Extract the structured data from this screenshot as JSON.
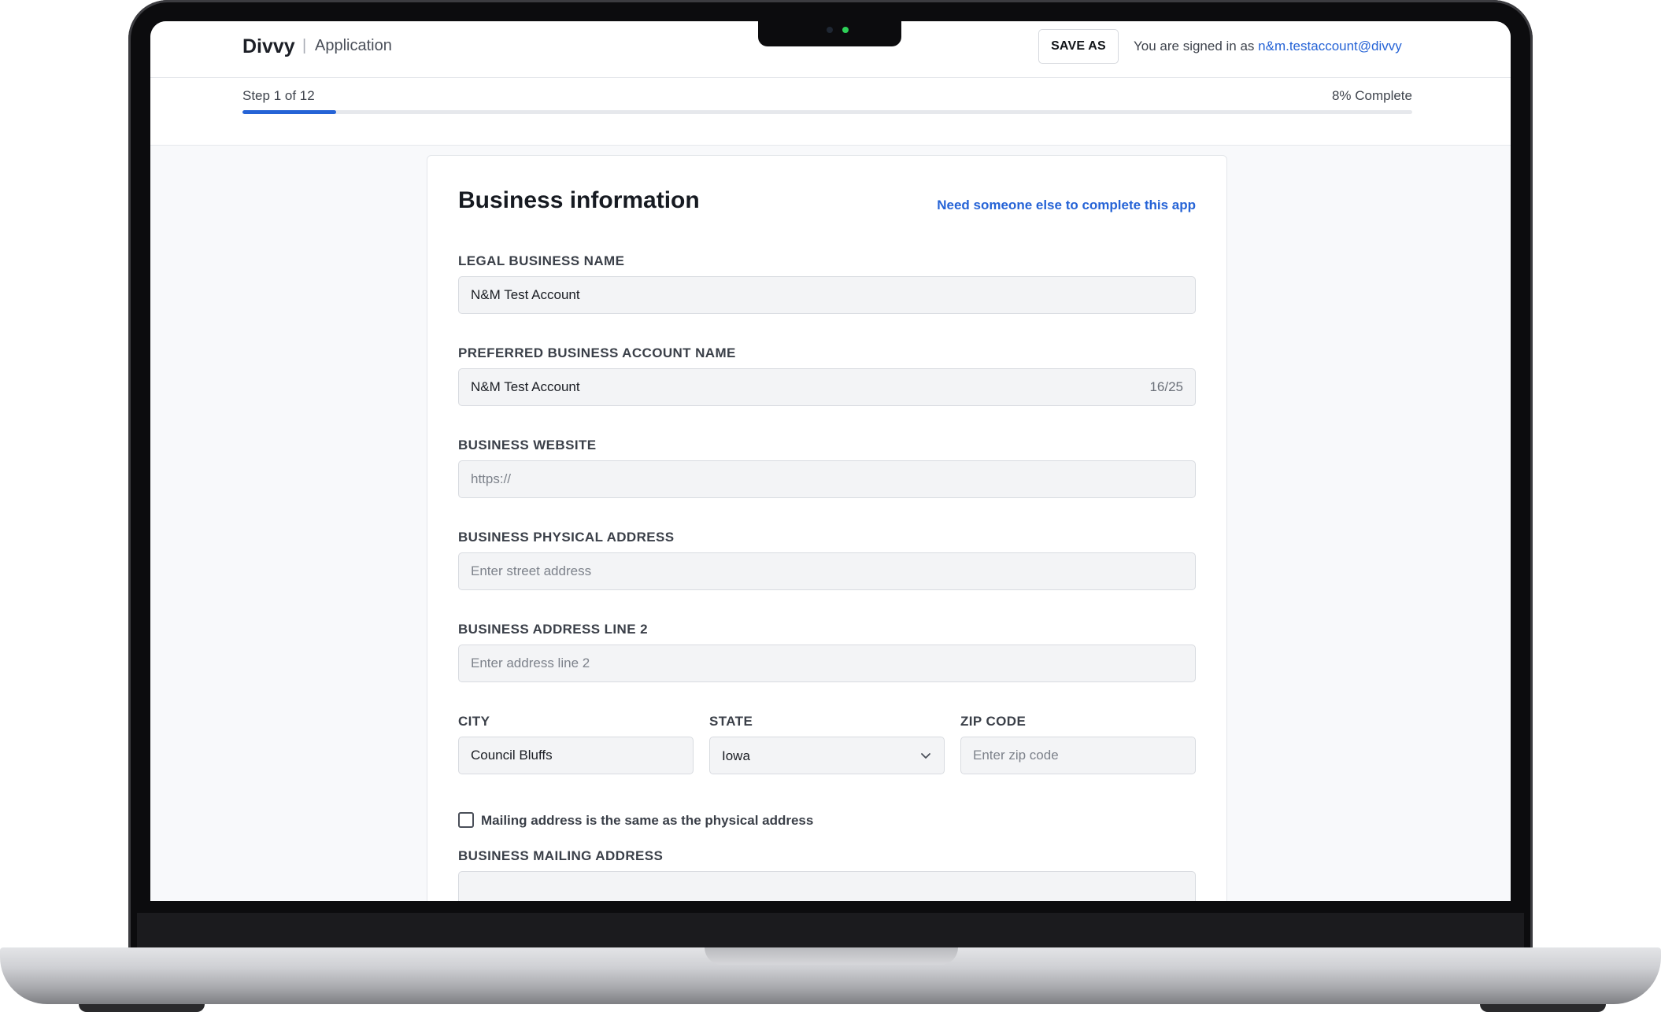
{
  "header": {
    "brand": "Divvy",
    "separator": "|",
    "app_section": "Application",
    "save_as_label": "SAVE AS",
    "signed_in_prefix": "You are signed in as ",
    "user_email": "n&m.testaccount@divvy"
  },
  "progress": {
    "step_text": "Step 1 of 12",
    "complete_text": "8% Complete",
    "percent": 8
  },
  "form": {
    "title": "Business information",
    "help_link": "Need someone else to complete this app",
    "legal_name": {
      "label": "LEGAL BUSINESS NAME",
      "value": "N&M Test Account"
    },
    "account_name": {
      "label": "PREFERRED BUSINESS ACCOUNT NAME",
      "value": "N&M Test Account",
      "char_count": "16/25"
    },
    "website": {
      "label": "BUSINESS WEBSITE",
      "placeholder": "https://"
    },
    "physical_address": {
      "label": "BUSINESS PHYSICAL ADDRESS",
      "placeholder": "Enter street address"
    },
    "address_line2": {
      "label": "BUSINESS ADDRESS LINE 2",
      "placeholder": "Enter address line 2"
    },
    "city": {
      "label": "CITY",
      "value": "Council Bluffs"
    },
    "state": {
      "label": "STATE",
      "value": "Iowa"
    },
    "zip": {
      "label": "ZIP CODE",
      "placeholder": "Enter zip code"
    },
    "mailing_same": {
      "label": "Mailing address is the same as the physical address",
      "checked": false
    },
    "mailing_address": {
      "label": "BUSINESS MAILING ADDRESS"
    }
  },
  "colors": {
    "accent": "#2563d6",
    "screen_background": "#f8f9fb",
    "input_background": "#f3f4f6"
  },
  "icons": {
    "state_dropdown": "chevron-down-icon"
  }
}
